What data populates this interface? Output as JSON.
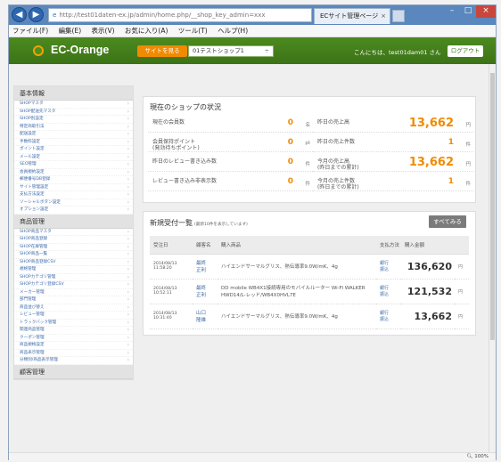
{
  "browser": {
    "address": "http://test01daten-ex.jp/admin/home.php/__shop_key_admin=xxx",
    "tab_title": "ECサイト管理ページ",
    "menu": [
      "ファイル(F)",
      "編集(E)",
      "表示(V)",
      "お気に入り(A)",
      "ツール(T)",
      "ヘルプ(H)"
    ],
    "zoom": "100%"
  },
  "header": {
    "logo": "EC-Orange",
    "site_button": "サイトを見る",
    "shop_select": "01テストショップ1",
    "greeting": "こんにちは、test01dam01 さん",
    "logout": "ログアウト"
  },
  "sidebar": {
    "sections": [
      {
        "title": "基本情報",
        "items": [
          "SHOPマスタ",
          "SHOP配送先マスタ",
          "SHOP別設定",
          "特定商取引法",
          "配送設定",
          "手数料設定",
          "ポイント設定",
          "メール設定",
          "SEO管理",
          "会員規約設定",
          "郵便番号DB登録",
          "サイト管理設定",
          "支払方法設定",
          "ソーシャルボタン設定",
          "オプション設定"
        ]
      },
      {
        "title": "商品管理",
        "items": [
          "SHOP商品マスタ",
          "SHOP商品登録",
          "SHOP在庫管理",
          "SHOP商品一覧",
          "SHOP商品登録CSV",
          "規格管理",
          "SHOPカテゴリ管理",
          "SHOPカテゴリ登録CSV",
          "メーカー管理",
          "部門管理",
          "商品並び替え",
          "レビュー管理",
          "トラックバック管理",
          "関連商品管理",
          "クーポン管理",
          "商品規格設定",
          "商品表示管理",
          "分類別/商品表示管理"
        ]
      },
      {
        "title": "顧客管理",
        "items": []
      }
    ]
  },
  "status": {
    "title": "現在のショップの状況",
    "stats": [
      {
        "label": "現在の会員数",
        "value": "0",
        "unit": "名"
      },
      {
        "label": "昨日の売上高",
        "value": "13,662",
        "unit": "円"
      },
      {
        "label": "会員保持ポイント\n(発効待ちポイント)",
        "value": "0",
        "unit": "pt"
      },
      {
        "label": "昨日の売上件数",
        "value": "1",
        "unit": "件"
      },
      {
        "label": "昨日のレビュー書き込み数",
        "value": "0",
        "unit": "件"
      },
      {
        "label": "今月の売上高\n(昨日までの累計)",
        "value": "13,662",
        "unit": "円"
      },
      {
        "label": "レビュー書き込み非表示数",
        "value": "0",
        "unit": "件"
      },
      {
        "label": "今月の売上件数\n(昨日までの累計)",
        "value": "1",
        "unit": "件"
      }
    ]
  },
  "orders": {
    "title": "新規受付一覧",
    "subtitle": "(最新10件を表示しています)",
    "see_all": "すべてみる",
    "columns": [
      "受注日",
      "顧客名",
      "購入商品",
      "支払方法",
      "購入金額"
    ],
    "rows": [
      {
        "date": "2014/08/13\n11:58:20",
        "customer": "最終\n正利",
        "product": "ハイエンドサーマルグリス、熱伝導率9.0W/mK、4g",
        "payment": "銀行\n振込",
        "amount": "136,620",
        "yen": "円"
      },
      {
        "date": "2014/08/13\n10:52:11",
        "customer": "最終\n正利",
        "product": "DD mobile WB4X1接続専用のモバイルルーター Wi-Fi WALKER HWD14/L-レッド/WB4X0HVL7E",
        "payment": "銀行\n振込",
        "amount": "121,532",
        "yen": "円"
      },
      {
        "date": "2014/08/13\n10:31:40",
        "customer": "山口\n隆雄",
        "product": "ハイエンドサーマルグリス、熱伝導率9.0W/mK、4g",
        "payment": "銀行\n振込",
        "amount": "13,662",
        "yen": "円"
      }
    ]
  }
}
